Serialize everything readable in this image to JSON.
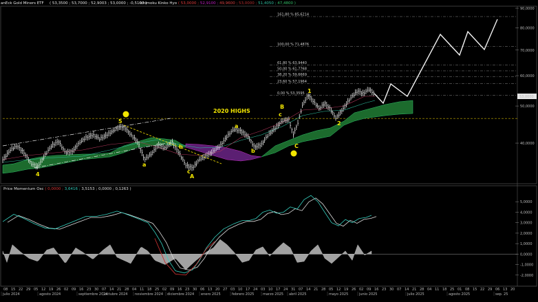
{
  "header": {
    "title": "anEck Gold Miners ETF",
    "ohlc": "( 53,3500 ; 53,7000 ; 52,9003 ; 53,0000 ; -0,5100 )",
    "ichimoku_label": "Ichimoku Kinko Hyo",
    "ichimoku_vals": [
      "( 53,0000 ;",
      "52,9100 ;",
      "49,9600 ;",
      "53,0000 ;",
      "51,4050 ;",
      "47,4800 )"
    ],
    "ichimoku_colors": [
      "#e03b3b",
      "#c21fc2",
      "#d64040",
      "#b52e2e",
      "#2fbfa0",
      "#35c26a"
    ]
  },
  "osc_header": {
    "title": "Price Momentum Osc",
    "vals": [
      "( 0,0000 ;",
      "3,6416 ;",
      "3,5153 ;",
      "0,0000 ;",
      "0,1263 )"
    ],
    "colors": [
      "#e03b3b",
      "#36d1c0",
      "#e0e0e0",
      "#e0e0e0",
      "#e0e0e0"
    ]
  },
  "chart_data": [
    {
      "type": "line",
      "title": "anEck Gold Miners ETF",
      "y_scale": "log",
      "ylim": [
        32,
        90
      ],
      "y_ticks": [
        "90,0000",
        "80,0000",
        "70,0000",
        "60,0000",
        "50,0000",
        "40,0000"
      ],
      "y_tick_values": [
        90,
        80,
        70,
        60,
        50,
        40
      ],
      "last_price": "53,0000",
      "fib_levels": [
        {
          "label": "161,80 % 85,6214",
          "value": 85.6214
        },
        {
          "label": "100,00 % 71,4876",
          "value": 71.4876
        },
        {
          "label": "61,80 % 63,9440",
          "value": 63.944
        },
        {
          "label": "50,00 % 61,7768",
          "value": 61.7768
        },
        {
          "label": "38,20 % 59,6669",
          "value": 59.6669
        },
        {
          "label": "23,60 % 57,1964",
          "value": 57.1964
        },
        {
          "label": "0,00 % 53,3595",
          "value": 53.3595
        }
      ],
      "reference_line": {
        "label": "2020 HIGHS",
        "value": 46.4
      },
      "annotations": [
        "1",
        "5",
        "4",
        "a",
        "b",
        "c",
        "A",
        "B",
        "C",
        "2",
        "1",
        "2",
        "a",
        "b",
        "c"
      ],
      "x_day_ticks": [
        "08",
        "15",
        "22",
        "29",
        "05",
        "12",
        "19",
        "26",
        "02",
        "09",
        "16",
        "23",
        "30",
        "07",
        "14",
        "21",
        "28",
        "04",
        "11",
        "18",
        "25",
        "02",
        "09",
        "16",
        "23",
        "30",
        "06",
        "13",
        "20",
        "27",
        "03",
        "10",
        "17",
        "24",
        "03",
        "10",
        "17",
        "24",
        "31",
        "07",
        "14",
        "21",
        "28",
        "05",
        "12",
        "19",
        "26",
        "02",
        "09",
        "16",
        "23",
        "30",
        "07",
        "14",
        "21",
        "28",
        "04",
        "11",
        "18",
        "25",
        "01",
        "08",
        "15",
        "22",
        "29",
        "06",
        "13",
        "20"
      ],
      "x_month_labels": [
        "julio 2024",
        "agosto 2024",
        "septiembre 2024",
        "octubre 2024",
        "noviembre 2024",
        "diciembre 2024",
        "enero 2025",
        "febrero 2025",
        "marzo 2025",
        "abril 2025",
        "mayo 2025",
        "junio 2025",
        "julio 2025",
        "agosto 2025",
        "sep. 25"
      ]
    },
    {
      "type": "line",
      "title": "Price Momentum Osc",
      "ylim": [
        -2.8,
        6
      ],
      "y_ticks": [
        "5,0000",
        "4,0000",
        "3,0000",
        "2,0000",
        "1,0000",
        "0,0000",
        "-1,0000",
        "-2,0000"
      ],
      "y_tick_values": [
        5,
        4,
        3,
        2,
        1,
        0,
        -1,
        -2
      ],
      "series": [
        {
          "values_note": "",
          "color": "#36d1c0"
        },
        {
          "color": "#e0e0e0"
        }
      ]
    }
  ]
}
